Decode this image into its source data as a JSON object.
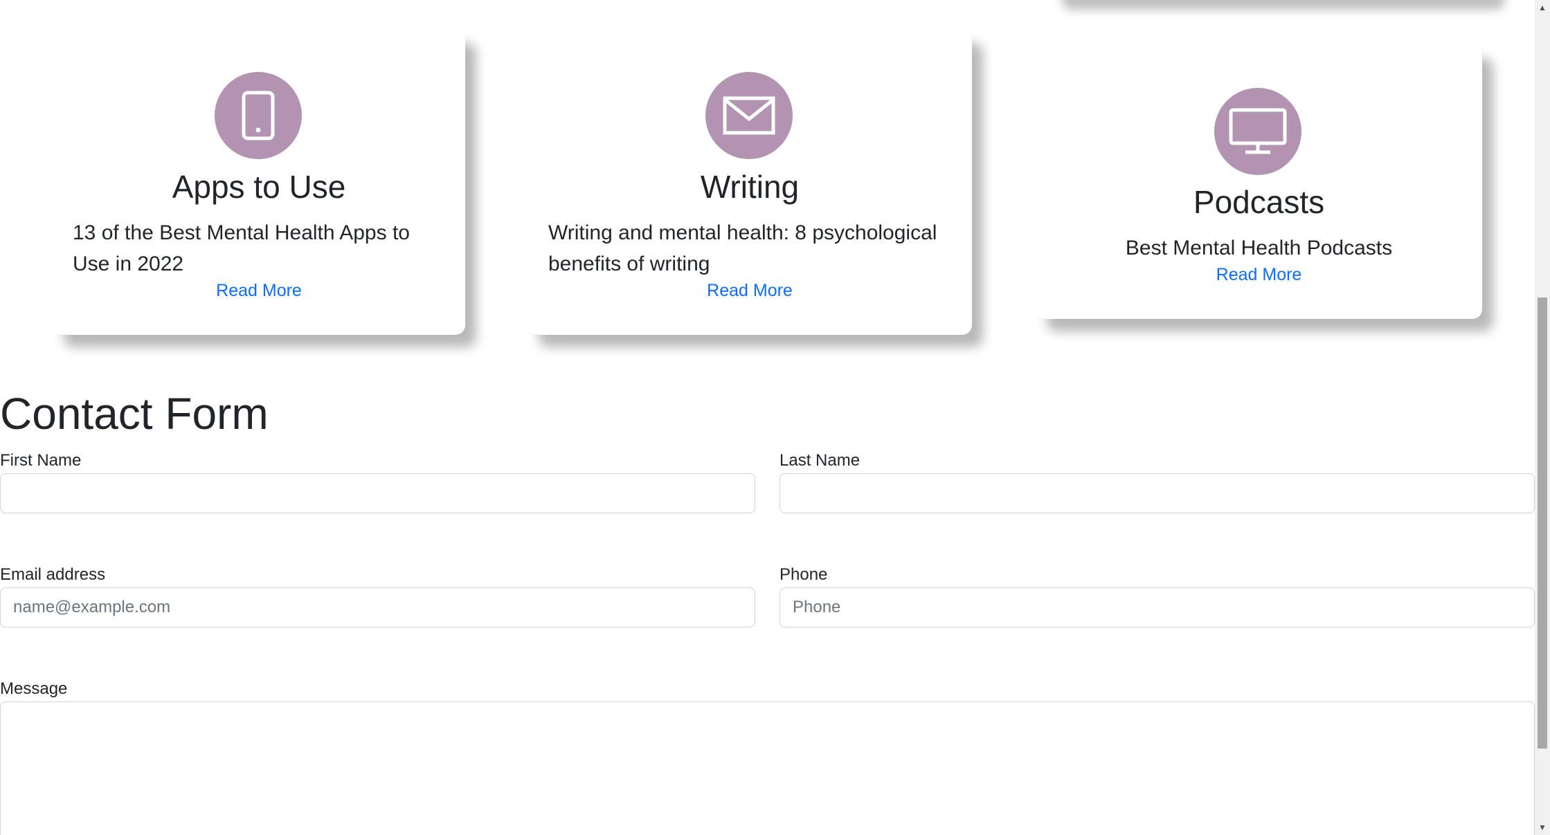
{
  "cards": [
    {
      "title": "Apps to Use",
      "description": "13 of the Best Mental Health Apps to Use in 2022",
      "link": "Read More",
      "icon": "tablet-icon"
    },
    {
      "title": "Writing",
      "description": "Writing and mental health: 8 psychological benefits of writing",
      "link": "Read More",
      "icon": "envelope-icon"
    },
    {
      "title": "Podcasts",
      "description": "Best Mental Health Podcasts",
      "link": "Read More",
      "icon": "monitor-icon"
    }
  ],
  "contact_form": {
    "title": "Contact Form",
    "first_name": {
      "label": "First Name",
      "value": "",
      "placeholder": ""
    },
    "last_name": {
      "label": "Last Name",
      "value": "",
      "placeholder": ""
    },
    "email": {
      "label": "Email address",
      "value": "",
      "placeholder": "name@example.com"
    },
    "phone": {
      "label": "Phone",
      "value": "",
      "placeholder": "Phone"
    },
    "message": {
      "label": "Message",
      "value": ""
    }
  },
  "colors": {
    "icon_circle": "#b393b2",
    "link": "#0d6efd",
    "text": "#212529",
    "input_border": "#ced4da"
  }
}
